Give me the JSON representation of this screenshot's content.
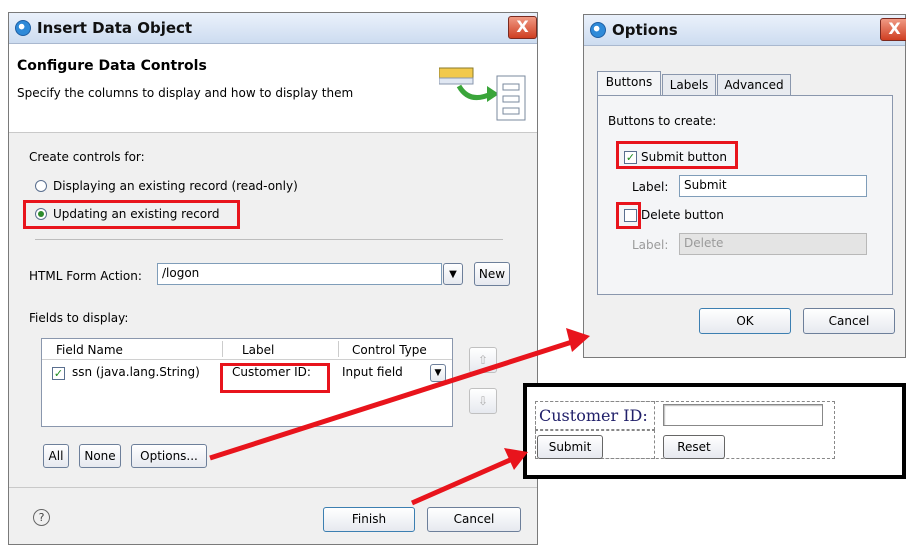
{
  "insert_dialog": {
    "title": "Insert Data Object",
    "close_glyph": "X",
    "header_title": "Configure Data Controls",
    "header_desc": "Specify the columns to display and how to display them",
    "create_controls_label": "Create controls for:",
    "radio_readonly": "Displaying an existing record (read-only)",
    "radio_update": "Updating an existing record",
    "form_action_label": "HTML Form Action:",
    "form_action_value": "/logon",
    "new_button": "New",
    "fields_label": "Fields to display:",
    "table": {
      "headers": [
        "Field Name",
        "Label",
        "Control Type"
      ],
      "rows": [
        {
          "field": "ssn (java.lang.String)",
          "label": "Customer ID:",
          "control": "Input field"
        }
      ]
    },
    "all_button": "All",
    "none_button": "None",
    "options_button": "Options...",
    "help_glyph": "?",
    "finish_button": "Finish",
    "cancel_button": "Cancel"
  },
  "options_dialog": {
    "title": "Options",
    "close_glyph": "X",
    "tabs": [
      "Buttons",
      "Labels",
      "Advanced"
    ],
    "buttons_to_create": "Buttons to create:",
    "submit_checkbox": "Submit button",
    "label_text": "Label:",
    "submit_label_value": "Submit",
    "delete_checkbox": "Delete button",
    "delete_label_value": "Delete",
    "ok_button": "OK",
    "cancel_button": "Cancel"
  },
  "preview": {
    "customer_label": "Customer ID:",
    "submit_button": "Submit",
    "reset_button": "Reset"
  },
  "colors": {
    "highlight": "#e8141c",
    "arrow": "#e8141c"
  }
}
